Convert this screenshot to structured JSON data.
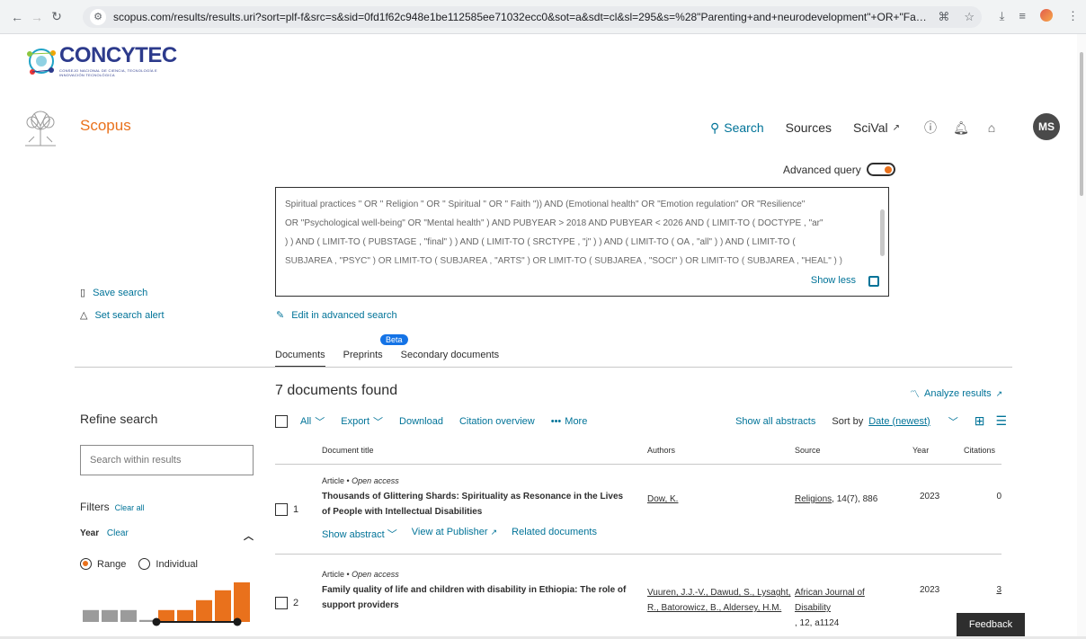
{
  "browser": {
    "url": "scopus.com/results/results.uri?sort=plf-f&src=s&sid=0fd1f62c948e1be112585ee71032ecc0&sot=a&sdt=cl&sl=295&s=%28\"Parenting+and+neurodevelopment\"+OR+\"Families+of+chil..."
  },
  "brand": {
    "concytec": "CONCYTEC",
    "concytec_sub": "CONSEJO NACIONAL DE CIENCIA, TECNOLOGÍA E INNOVACIÓN TECNOLÓGICA",
    "scopus": "Scopus"
  },
  "topnav": {
    "search": "Search",
    "sources": "Sources",
    "scival": "SciVal",
    "avatar": "MS"
  },
  "advanced": {
    "label": "Advanced query",
    "query_lines": [
      "Spiritual practices \" OR \" Religion \" OR \" Spiritual \" OR \" Faith \")) AND (Emotional health\" OR \"Emotion regulation\" OR \"Resilience\"",
      "OR \"Psychological well-being\" OR \"Mental health\" ) AND PUBYEAR > 2018 AND PUBYEAR < 2026 AND ( LIMIT-TO ( DOCTYPE , \"ar\"",
      ") ) AND ( LIMIT-TO ( PUBSTAGE , \"final\" ) ) AND ( LIMIT-TO ( SRCTYPE , \"j\" ) ) AND ( LIMIT-TO ( OA , \"all\" ) ) AND ( LIMIT-TO (",
      "SUBJAREA , \"PSYC\" ) OR LIMIT-TO ( SUBJAREA , \"ARTS\" ) OR LIMIT-TO ( SUBJAREA , \"SOCI\" ) OR LIMIT-TO ( SUBJAREA , \"HEAL\" ) )"
    ],
    "show_less": "Show less",
    "edit": "Edit in advanced search"
  },
  "left_actions": {
    "save": "Save search",
    "alert": "Set search alert"
  },
  "tabs": {
    "documents": "Documents",
    "preprints": "Preprints",
    "beta": "Beta",
    "secondary": "Secondary documents"
  },
  "results": {
    "count_text": "7 documents found",
    "analyze": "Analyze results"
  },
  "refine": {
    "title": "Refine search",
    "search_placeholder": "Search within results",
    "filters": "Filters",
    "clear_all": "Clear all",
    "year": "Year",
    "year_clear": "Clear",
    "range": "Range",
    "individual": "Individual"
  },
  "toolbar": {
    "all": "All",
    "export": "Export",
    "download": "Download",
    "citation_overview": "Citation overview",
    "more": "More",
    "show_all_abstracts": "Show all abstracts",
    "sort_by": "Sort by",
    "sort_value": "Date (newest)"
  },
  "table": {
    "headers": {
      "title": "Document title",
      "authors": "Authors",
      "source": "Source",
      "year": "Year",
      "citations": "Citations"
    },
    "rows": [
      {
        "num": "1",
        "type": "Article",
        "access": "Open access",
        "title": "Thousands of Glittering Shards: Spirituality as Resonance in the Lives of People with Intellectual Disabilities",
        "authors": "Dow, K.",
        "source_name": "Religions",
        "source_detail": ", 14(7), 886",
        "year": "2023",
        "citations": "0",
        "show_abstract": "Show abstract",
        "view_publisher": "View at Publisher",
        "related": "Related documents"
      },
      {
        "num": "2",
        "type": "Article",
        "access": "Open access",
        "title": "Family quality of life and children with disability in Ethiopia: The role of support providers",
        "authors": "Vuuren, J.J.-V., Dawud, S., Lysaght, R., Batorowicz, B., Aldersey, H.M.",
        "source_name": "African Journal of Disability",
        "source_detail": ", 12, a1124",
        "year": "2023",
        "citations": "3"
      }
    ]
  },
  "histogram": {
    "values": [
      0.3,
      0.3,
      0.3,
      0.05,
      0.3,
      0.3,
      0.55,
      0.8,
      1.0
    ]
  },
  "feedback": "Feedback",
  "colors": {
    "accent": "#e9711c",
    "link": "#007398",
    "beta": "#1473e6"
  }
}
